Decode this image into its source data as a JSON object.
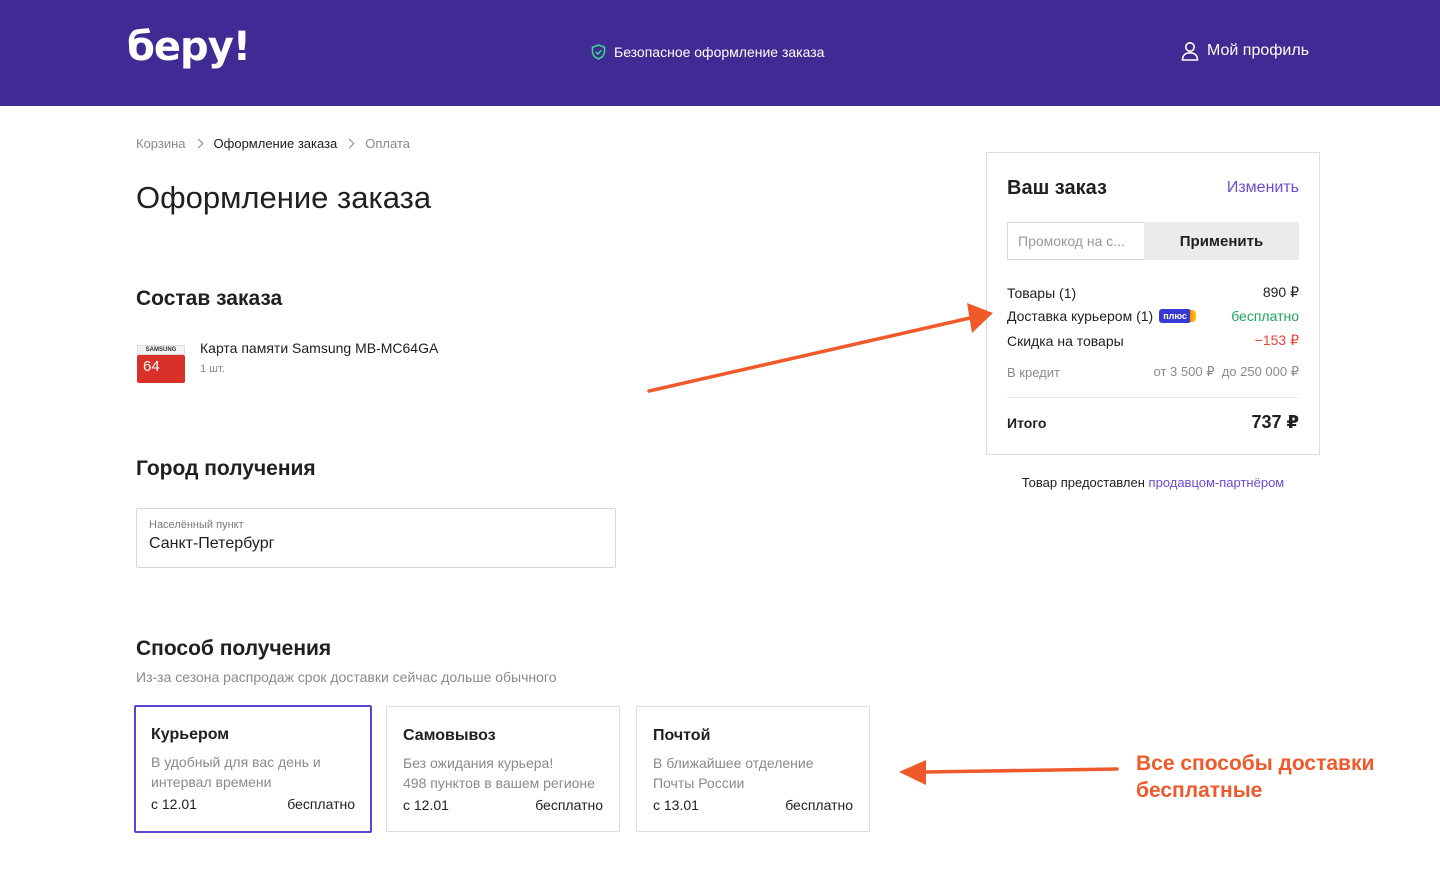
{
  "header": {
    "logo": "беру!",
    "secure_text": "Безопасное оформление заказа",
    "profile_label": "Мой профиль",
    "brand_color": "#3f2b93"
  },
  "breadcrumb": [
    "Корзина",
    "Оформление заказа",
    "Оплата"
  ],
  "page_title": "Оформление заказа",
  "order_contents": {
    "heading": "Состав заказа",
    "item": {
      "name": "Карта памяти Samsung MB-MC64GA",
      "qty": "1 шт.",
      "image_brand": "SAMSUNG",
      "image_capacity": "64"
    }
  },
  "city": {
    "heading": "Город получения",
    "field_label": "Населённый пункт",
    "field_value": "Санкт-Петербург"
  },
  "delivery": {
    "heading": "Способ получения",
    "note": "Из-за сезона распродаж срок доставки сейчас дольше обычного",
    "options": [
      {
        "title": "Курьером",
        "desc1": "В удобный для вас день и",
        "desc2": "интервал времени",
        "date": "с 12.01",
        "price": "бесплатно",
        "selected": true
      },
      {
        "title": "Самовывоз",
        "desc1": "Без ожидания курьера!",
        "desc2": "498 пунктов в вашем регионе",
        "date": "с 12.01",
        "price": "бесплатно",
        "selected": false
      },
      {
        "title": "Почтой",
        "desc1": "В ближайшее отделение",
        "desc2": "Почты России",
        "date": "с 13.01",
        "price": "бесплатно",
        "selected": false
      }
    ]
  },
  "summary": {
    "title": "Ваш заказ",
    "edit": "Изменить",
    "promo_placeholder": "Промокод на с...",
    "apply": "Применить",
    "goods_label": "Товары (1)",
    "goods_value": "890 ₽",
    "delivery_label": "Доставка курьером (1)",
    "plus_badge": "плюс",
    "delivery_value": "бесплатно",
    "discount_label": "Скидка на товары",
    "discount_value": "−153 ₽",
    "credit_label": "В кредит",
    "credit_value": "от 3 500 ₽  до 250 000 ₽",
    "total_label": "Итого",
    "total_value": "737 ₽"
  },
  "seller_note": {
    "text": "Товар предоставлен ",
    "link": "продавцом-партнёром"
  },
  "annotation": {
    "line1": "Все способы доставки",
    "line2": "бесплатные",
    "color": "#f05a2a"
  }
}
